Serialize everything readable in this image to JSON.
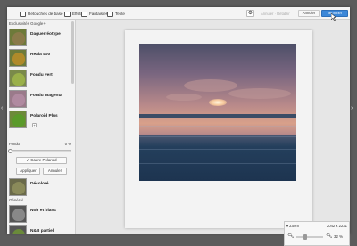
{
  "toolbar": {
    "tabs": [
      {
        "label": "Retouches de base"
      },
      {
        "label": "Effets"
      },
      {
        "label": "Fantaisies"
      },
      {
        "label": "Texte"
      }
    ],
    "undo_redo": "Annuler · Rétablir",
    "cancel_label": "Annuler",
    "finish_label": "Terminer"
  },
  "sidebar": {
    "section1": "Exclusivités Google+",
    "effects1": [
      {
        "label": "Daguerréotype"
      },
      {
        "label": "Reala 400"
      },
      {
        "label": "Fondu vert"
      },
      {
        "label": "Fondu magenta"
      },
      {
        "label": "Polaroid Plus",
        "plus": "+"
      }
    ],
    "fondu": {
      "label": "Fondu",
      "value": "0 %",
      "fraction": 0.0
    },
    "polaroid_toggle": "✔ Cadre Polaroid",
    "apply_label": "Appliquer",
    "undo_label": "Annuler",
    "effects2": [
      {
        "label": "Décoloré"
      }
    ],
    "section2": "Général",
    "effects3": [
      {
        "label": "Noir et blanc"
      },
      {
        "label": "N&B partiel"
      }
    ]
  },
  "zoom": {
    "label": "▾ Zoom",
    "dimensions": "2042 x 2231",
    "value": "32 %",
    "fraction": 0.32
  },
  "colors": {
    "accent": "#3b87d8",
    "workspace": "#e6e6e6",
    "frame": "#5c5c5c"
  },
  "icons": [
    "close-icon",
    "basic-edits-icon",
    "effects-icon",
    "fantasy-icon",
    "text-icon",
    "gear-icon",
    "zoom-out-icon",
    "zoom-in-icon",
    "arrow-left-icon",
    "arrow-right-icon"
  ]
}
